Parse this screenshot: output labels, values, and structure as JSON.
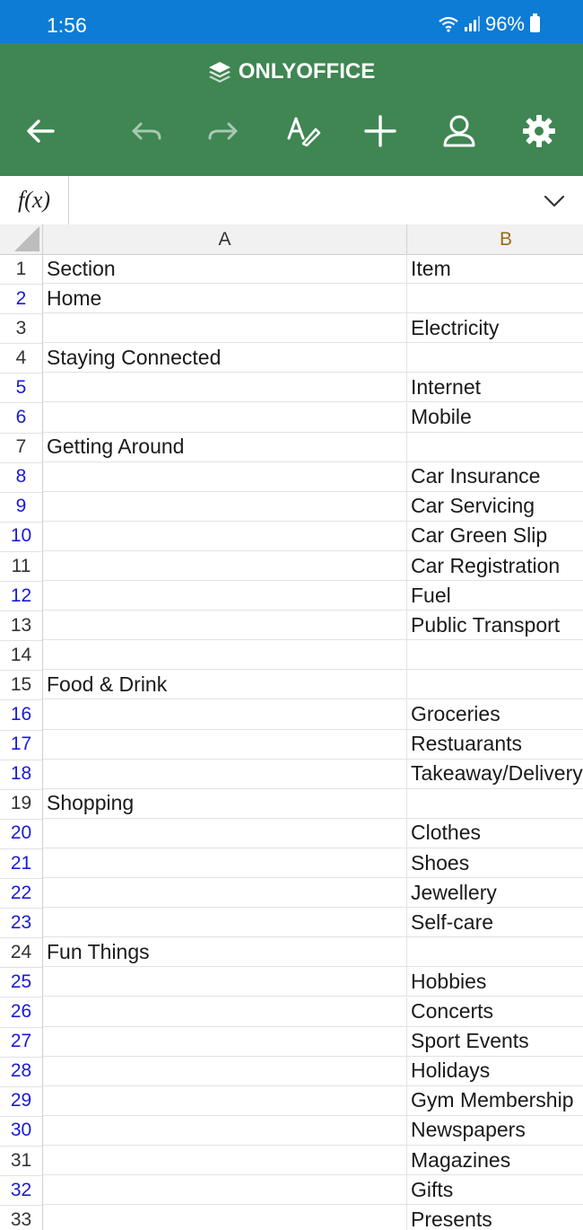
{
  "status": {
    "time": "1:56",
    "battery": "96%"
  },
  "app": {
    "brand": "ONLYOFFICE"
  },
  "formula": {
    "label": "f(x)",
    "value": ""
  },
  "colors": {
    "status_bar": "#0c7cd5",
    "app_bar": "#3f8652",
    "row_number": "#1a1ad6",
    "text_blue": "#1a1ad6",
    "text_orange": "#e07a10"
  },
  "columns": [
    "A",
    "B"
  ],
  "rows": [
    {
      "n": "1",
      "a": "Section",
      "b": "Item"
    },
    {
      "n": "2",
      "a": "Home",
      "b": ""
    },
    {
      "n": "3",
      "a": "",
      "b": "Electricity"
    },
    {
      "n": "4",
      "a": "Staying Connected",
      "b": ""
    },
    {
      "n": "5",
      "a": "",
      "b": "Internet"
    },
    {
      "n": "6",
      "a": "",
      "b": "Mobile"
    },
    {
      "n": "7",
      "a": "Getting Around",
      "b": ""
    },
    {
      "n": "8",
      "a": "",
      "b": "Car Insurance"
    },
    {
      "n": "9",
      "a": "",
      "b": "Car Servicing"
    },
    {
      "n": "10",
      "a": "",
      "b": "Car Green Slip"
    },
    {
      "n": "11",
      "a": "",
      "b": "Car Registration"
    },
    {
      "n": "12",
      "a": "",
      "b": "Fuel"
    },
    {
      "n": "13",
      "a": "",
      "b": "Public Transport"
    },
    {
      "n": "14",
      "a": "",
      "b": ""
    },
    {
      "n": "15",
      "a": "Food & Drink",
      "b": ""
    },
    {
      "n": "16",
      "a": "",
      "b": "Groceries"
    },
    {
      "n": "17",
      "a": "",
      "b": "Restuarants"
    },
    {
      "n": "18",
      "a": "",
      "b": "Takeaway/Delivery"
    },
    {
      "n": "19",
      "a": "Shopping",
      "b": ""
    },
    {
      "n": "20",
      "a": "",
      "b": "Clothes"
    },
    {
      "n": "21",
      "a": "",
      "b": "Shoes"
    },
    {
      "n": "22",
      "a": "",
      "b": "Jewellery"
    },
    {
      "n": "23",
      "a": "",
      "b": "Self-care"
    },
    {
      "n": "24",
      "a": "Fun Things",
      "b": ""
    },
    {
      "n": "25",
      "a": "",
      "b": "Hobbies"
    },
    {
      "n": "26",
      "a": "",
      "b": "Concerts"
    },
    {
      "n": "27",
      "a": "",
      "b": "Sport Events"
    },
    {
      "n": "28",
      "a": "",
      "b": "Holidays"
    },
    {
      "n": "29",
      "a": "",
      "b": "Gym Membership"
    },
    {
      "n": "30",
      "a": "",
      "b": "Newspapers"
    },
    {
      "n": "31",
      "a": "",
      "b": "Magazines"
    },
    {
      "n": "32",
      "a": "",
      "b": "Gifts"
    },
    {
      "n": "33",
      "a": "",
      "b": "Presents"
    }
  ]
}
